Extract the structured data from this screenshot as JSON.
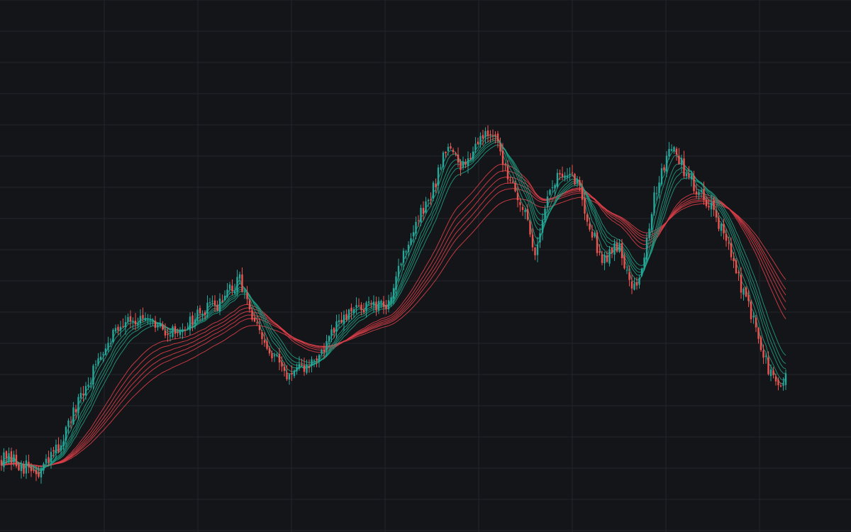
{
  "chart_data": {
    "type": "candlestick",
    "title": "",
    "xlabel": "",
    "ylabel": "",
    "grid": true,
    "ylim": [
      0,
      750
    ],
    "colors": {
      "background": "#141518",
      "grid": "#22252b",
      "up": "#26a69a",
      "down": "#ef5350",
      "ema_fast": "#1fa287",
      "ema_slow": "#e0404a"
    },
    "ema_groups": {
      "fast": {
        "periods": [
          3,
          5,
          8,
          10,
          12,
          15
        ],
        "color": "#1fa287"
      },
      "slow": {
        "periods": [
          30,
          35,
          40,
          45,
          50,
          60
        ],
        "color": "#e0404a"
      }
    },
    "price_path": [
      [
        0,
        105
      ],
      [
        30,
        95
      ],
      [
        55,
        80
      ],
      [
        85,
        125
      ],
      [
        120,
        200
      ],
      [
        150,
        270
      ],
      [
        180,
        305
      ],
      [
        215,
        290
      ],
      [
        245,
        280
      ],
      [
        280,
        305
      ],
      [
        310,
        325
      ],
      [
        340,
        355
      ],
      [
        355,
        300
      ],
      [
        380,
        250
      ],
      [
        410,
        220
      ],
      [
        430,
        230
      ],
      [
        455,
        255
      ],
      [
        475,
        290
      ],
      [
        510,
        320
      ],
      [
        545,
        315
      ],
      [
        560,
        370
      ],
      [
        585,
        430
      ],
      [
        610,
        480
      ],
      [
        630,
        550
      ],
      [
        650,
        510
      ],
      [
        668,
        545
      ],
      [
        690,
        570
      ],
      [
        710,
        520
      ],
      [
        725,
        490
      ],
      [
        740,
        445
      ],
      [
        755,
        395
      ],
      [
        770,
        470
      ],
      [
        790,
        505
      ],
      [
        815,
        495
      ],
      [
        835,
        420
      ],
      [
        850,
        385
      ],
      [
        870,
        405
      ],
      [
        890,
        355
      ],
      [
        900,
        345
      ],
      [
        920,
        460
      ],
      [
        945,
        550
      ],
      [
        965,
        510
      ],
      [
        985,
        480
      ],
      [
        1005,
        460
      ],
      [
        1020,
        420
      ],
      [
        1040,
        360
      ],
      [
        1055,
        320
      ],
      [
        1070,
        270
      ],
      [
        1085,
        225
      ],
      [
        1100,
        200
      ],
      [
        1108,
        215
      ]
    ]
  }
}
